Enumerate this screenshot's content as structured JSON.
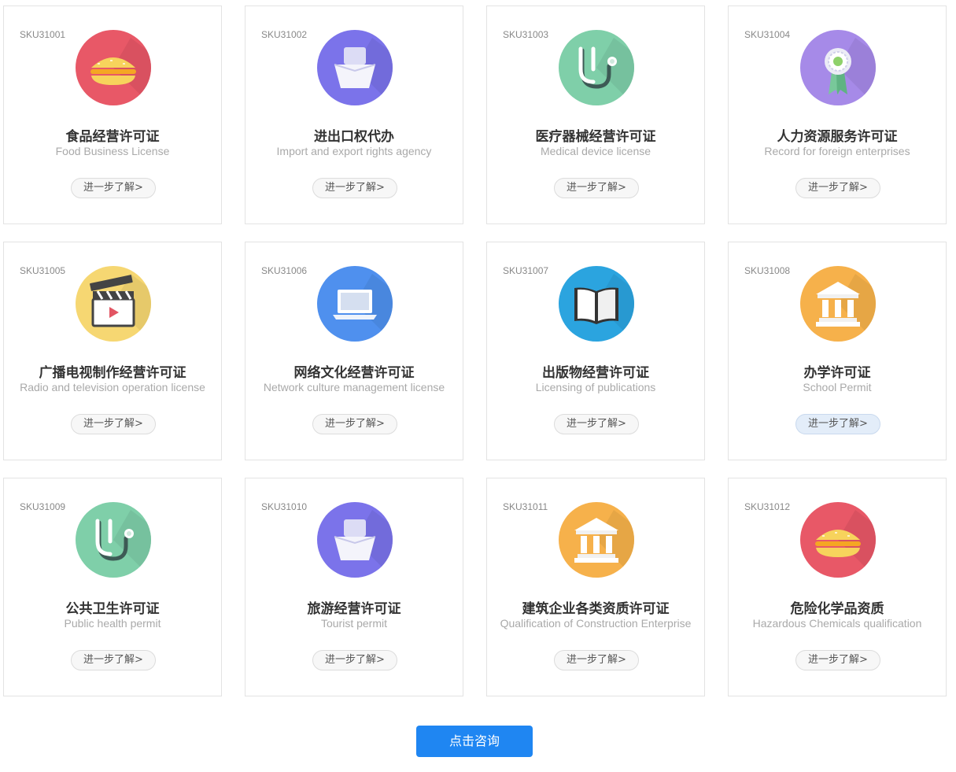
{
  "cards": [
    {
      "sku": "SKU31001",
      "title": "食品经营许可证",
      "subtitle": "Food Business License",
      "more": "进一步了解>",
      "icon": "burger-icon",
      "color": "#e85867"
    },
    {
      "sku": "SKU31002",
      "title": "进出口权代办",
      "subtitle": "Import and export rights agency",
      "more": "进一步了解>",
      "icon": "ship-icon",
      "color": "#7b73ea"
    },
    {
      "sku": "SKU31003",
      "title": "医疗器械经营许可证",
      "subtitle": "Medical device license",
      "more": "进一步了解>",
      "icon": "stethoscope-icon",
      "color": "#7fcfa9"
    },
    {
      "sku": "SKU31004",
      "title": "人力资源服务许可证",
      "subtitle": "Record for foreign enterprises",
      "more": "进一步了解>",
      "icon": "award-ribbon-icon",
      "color": "#a68ae8"
    },
    {
      "sku": "SKU31005",
      "title": "广播电视制作经营许可证",
      "subtitle": "Radio and television operation license",
      "more": "进一步了解>",
      "icon": "clapperboard-icon",
      "color": "#f6d772"
    },
    {
      "sku": "SKU31006",
      "title": "网络文化经营许可证",
      "subtitle": "Network culture management license",
      "more": "进一步了解>",
      "icon": "laptop-icon",
      "color": "#4f90ee"
    },
    {
      "sku": "SKU31007",
      "title": "出版物经营许可证",
      "subtitle": "Licensing of publications",
      "more": "进一步了解>",
      "icon": "open-book-icon",
      "color": "#2ba4df"
    },
    {
      "sku": "SKU31008",
      "title": "办学许可证",
      "subtitle": "School Permit",
      "more": "进一步了解>",
      "icon": "institution-icon",
      "color": "#f6b14b"
    },
    {
      "sku": "SKU31009",
      "title": "公共卫生许可证",
      "subtitle": "Public health permit",
      "more": "进一步了解>",
      "icon": "stethoscope-icon",
      "color": "#7fcfa9"
    },
    {
      "sku": "SKU31010",
      "title": "旅游经营许可证",
      "subtitle": "Tourist permit",
      "more": "进一步了解>",
      "icon": "ship-icon",
      "color": "#7b73ea"
    },
    {
      "sku": "SKU31011",
      "title": "建筑企业各类资质许可证",
      "subtitle": "Qualification of Construction Enterprise",
      "more": "进一步了解>",
      "icon": "institution-icon",
      "color": "#f6b14b"
    },
    {
      "sku": "SKU31012",
      "title": "危险化学品资质",
      "subtitle": "Hazardous Chemicals qualification",
      "more": "进一步了解>",
      "icon": "burger-icon",
      "color": "#e85867"
    }
  ],
  "active_more_index": 7,
  "consult_button": "点击咨询"
}
